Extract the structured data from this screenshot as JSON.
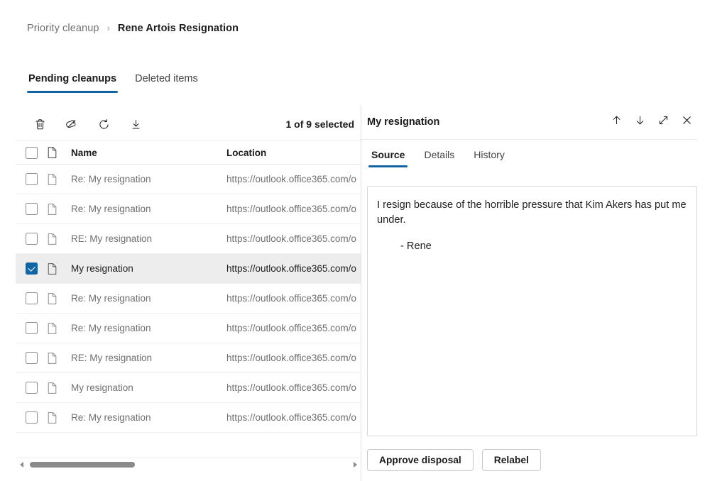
{
  "breadcrumb": {
    "root": "Priority cleanup",
    "separator": "›",
    "current": "Rene Artois Resignation"
  },
  "main_tabs": [
    {
      "label": "Pending cleanups",
      "active": true
    },
    {
      "label": "Deleted items",
      "active": false
    }
  ],
  "toolbar": {
    "buttons": [
      {
        "name": "delete-button",
        "icon": "trash-icon",
        "label": "Delete"
      },
      {
        "name": "remove-label-button",
        "icon": "tag-slash-icon",
        "label": "Remove label"
      },
      {
        "name": "refresh-button",
        "icon": "refresh-icon",
        "label": "Refresh"
      },
      {
        "name": "download-button",
        "icon": "download-icon",
        "label": "Download"
      }
    ],
    "selection_status": "1 of 9 selected"
  },
  "list": {
    "columns": {
      "name": "Name",
      "location": "Location"
    },
    "rows": [
      {
        "name": "Re: My resignation",
        "location": "https://outlook.office365.com/o",
        "selected": false
      },
      {
        "name": "Re: My resignation",
        "location": "https://outlook.office365.com/o",
        "selected": false
      },
      {
        "name": "RE: My resignation",
        "location": "https://outlook.office365.com/o",
        "selected": false
      },
      {
        "name": "My resignation",
        "location": "https://outlook.office365.com/o",
        "selected": true
      },
      {
        "name": "Re: My resignation",
        "location": "https://outlook.office365.com/o",
        "selected": false
      },
      {
        "name": "Re: My resignation",
        "location": "https://outlook.office365.com/o",
        "selected": false
      },
      {
        "name": "RE: My resignation",
        "location": "https://outlook.office365.com/o",
        "selected": false
      },
      {
        "name": "My resignation",
        "location": "https://outlook.office365.com/o",
        "selected": false
      },
      {
        "name": "Re: My resignation",
        "location": "https://outlook.office365.com/o",
        "selected": false
      }
    ]
  },
  "panel": {
    "title": "My resignation",
    "actions": [
      {
        "name": "previous-item-button",
        "icon": "arrow-up-icon"
      },
      {
        "name": "next-item-button",
        "icon": "arrow-down-icon"
      },
      {
        "name": "expand-button",
        "icon": "expand-diagonal-icon"
      },
      {
        "name": "close-button",
        "icon": "close-icon"
      }
    ],
    "tabs": [
      {
        "label": "Source",
        "active": true
      },
      {
        "label": "Details",
        "active": false
      },
      {
        "label": "History",
        "active": false
      }
    ],
    "source": {
      "body": "I resign because of the horrible pressure that Kim Akers has put me under.",
      "signature": "- Rene"
    },
    "footer": {
      "approve_label": "Approve disposal",
      "relabel_label": "Relabel"
    }
  },
  "scrollbar": {
    "left_arrow": "◀",
    "right_arrow": "▶"
  },
  "colors": {
    "accent": "#1264a3",
    "selected_row_bg": "#ededed",
    "text_primary": "#1b1b1b",
    "text_secondary": "#6f6f6f"
  }
}
